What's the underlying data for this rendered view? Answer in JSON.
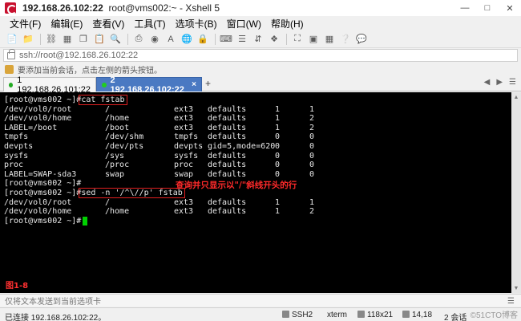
{
  "window": {
    "title_host": "192.168.26.102:22",
    "title_rest": "root@vms002:~ - Xshell 5"
  },
  "menu": [
    "文件(F)",
    "编辑(E)",
    "查看(V)",
    "工具(T)",
    "选项卡(B)",
    "窗口(W)",
    "帮助(H)"
  ],
  "address": {
    "value": "ssh://root@192.168.26.102:22"
  },
  "hint": {
    "text": "要添加当前会话，点击左侧的箭头按钮。"
  },
  "tabs": [
    {
      "label": "1 192.168.26.101:22",
      "active": false,
      "status_color": "#22aa22"
    },
    {
      "label": "2 192.168.26.102:22",
      "active": true,
      "status_color": "#22cc22"
    }
  ],
  "terminal": {
    "prompt": "[root@vms002 ~]#",
    "command1": "cat fstab",
    "fstab_rows": [
      [
        "/dev/vol0/root",
        "/",
        "ext3",
        "defaults",
        "1",
        "1"
      ],
      [
        "/dev/vol0/home",
        "/home",
        "ext3",
        "defaults",
        "1",
        "2"
      ],
      [
        "LABEL=/boot",
        "/boot",
        "ext3",
        "defaults",
        "1",
        "2"
      ],
      [
        "tmpfs",
        "/dev/shm",
        "tmpfs",
        "defaults",
        "0",
        "0"
      ],
      [
        "devpts",
        "/dev/pts",
        "devpts",
        "gid=5,mode=620",
        "0",
        "0"
      ],
      [
        "sysfs",
        "/sys",
        "sysfs",
        "defaults",
        "0",
        "0"
      ],
      [
        "proc",
        "/proc",
        "proc",
        "defaults",
        "0",
        "0"
      ],
      [
        "LABEL=SWAP-sda3",
        "swap",
        "swap",
        "defaults",
        "0",
        "0"
      ]
    ],
    "command2": "sed -n '/^\\//p' fstab",
    "annotation": "查询并只显示以\"/\"斜线开头的行",
    "filtered_rows": [
      [
        "/dev/vol0/root",
        "/",
        "ext3",
        "defaults",
        "1",
        "1"
      ],
      [
        "/dev/vol0/home",
        "/home",
        "ext3",
        "defaults",
        "1",
        "2"
      ]
    ],
    "figure_label": "图1-8"
  },
  "sendbar": {
    "placeholder": "仅将文本发送到当前选项卡"
  },
  "status": {
    "connected": "已连接 192.168.26.102:22。",
    "protocol": "SSH2",
    "terminal": "xterm",
    "size": "118x21",
    "cursor": "14,18",
    "sessions": "2 会话"
  },
  "watermark": "©51CTO博客"
}
